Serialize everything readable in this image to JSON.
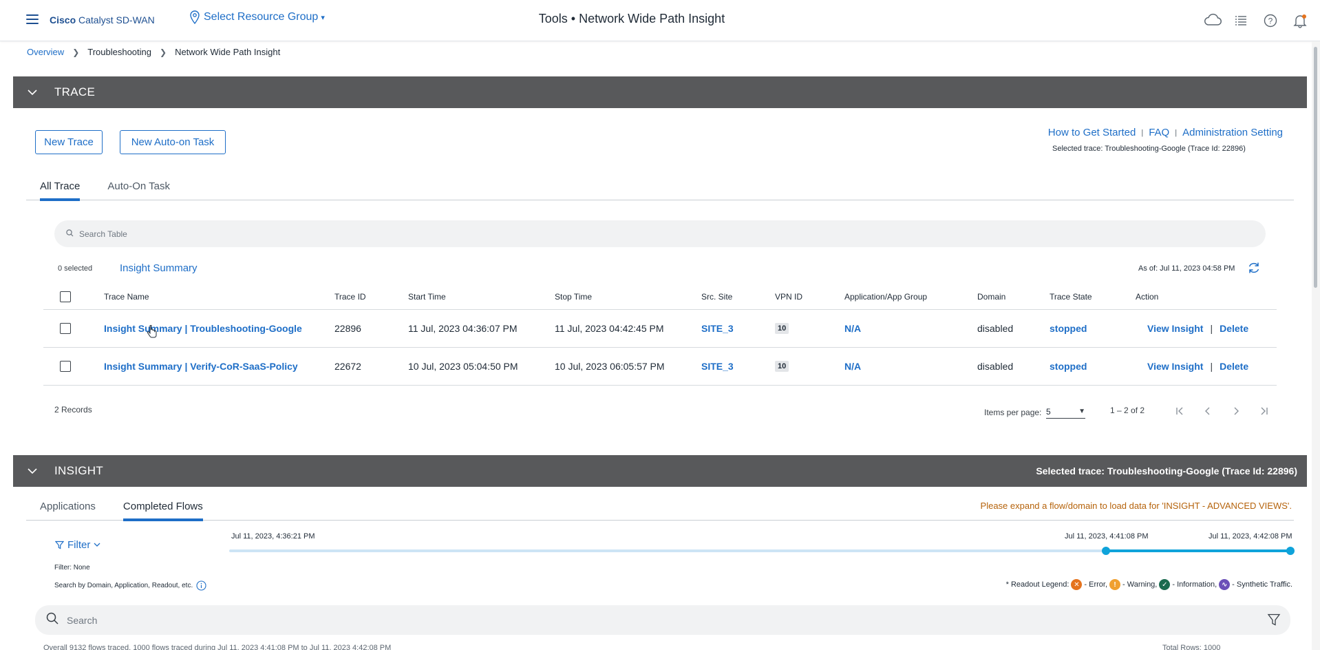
{
  "header": {
    "brand_bold": "Cisco",
    "brand_rest": " Catalyst SD-WAN",
    "resource_group": "Select Resource Group",
    "title_prefix": "Tools • ",
    "title_main": "Network Wide Path Insight"
  },
  "breadcrumb": {
    "items": [
      "Overview",
      "Troubleshooting",
      "Network Wide Path Insight"
    ]
  },
  "trace": {
    "section_title": "TRACE",
    "new_trace_label": "New Trace",
    "new_auto_task_label": "New Auto-on Task",
    "links": [
      "How to Get Started",
      "FAQ",
      "Administration Setting"
    ],
    "selected_trace": "Selected trace: Troubleshooting-Google (Trace Id: 22896)",
    "tabs": [
      "All Trace",
      "Auto-On Task"
    ],
    "search_placeholder": "Search Table",
    "selected_count": "0 selected",
    "insight_summary_label": "Insight Summary",
    "as_of": "As of:  Jul 11, 2023 04:58 PM",
    "columns": [
      "Trace Name",
      "Trace ID",
      "Start Time",
      "Stop Time",
      "Src. Site",
      "VPN ID",
      "Application/App Group",
      "Domain",
      "Trace State",
      "Action"
    ],
    "rows": [
      {
        "name_prefix": "Insight Summary",
        "name_sep": " | ",
        "name": "Troubleshooting-Google",
        "trace_id": "22896",
        "start": "11 Jul, 2023 04:36:07 PM",
        "stop": "11 Jul, 2023 04:42:45 PM",
        "site": "SITE_3",
        "vpn": "10",
        "app": "N/A",
        "domain": "disabled",
        "state": "stopped",
        "view": "View Insight",
        "delete": "Delete"
      },
      {
        "name_prefix": "Insight Summary",
        "name_sep": " | ",
        "name": "Verify-CoR-SaaS-Policy",
        "trace_id": "22672",
        "start": "10 Jul, 2023 05:04:50 PM",
        "stop": "10 Jul, 2023 06:05:57 PM",
        "site": "SITE_3",
        "vpn": "10",
        "app": "N/A",
        "domain": "disabled",
        "state": "stopped",
        "view": "View Insight",
        "delete": "Delete"
      }
    ],
    "records": "2 Records",
    "items_per_page_label": "Items per page:",
    "items_per_page": "5",
    "range": "1 – 2 of 2"
  },
  "insight": {
    "section_title": "INSIGHT",
    "selected_trace": "Selected trace: Troubleshooting-Google (Trace Id: 22896)",
    "tabs": [
      "Applications",
      "Completed Flows"
    ],
    "notice": "Please expand a flow/domain to load data for 'INSIGHT - ADVANCED VIEWS'.",
    "filter_label": "Filter",
    "filter_value": "Filter: None",
    "search_hint": "Search by Domain, Application, Readout, etc.",
    "timeline_labels": [
      "Jul 11, 2023, 4:36:21 PM",
      "Jul 11, 2023, 4:41:08 PM",
      "Jul 11, 2023, 4:42:08 PM"
    ],
    "legend_prefix": "* Readout Legend:",
    "legend_items": [
      "- Error,",
      "- Warning,",
      "- Information,",
      "- Synthetic Traffic."
    ],
    "search_placeholder": "Search",
    "bottom_left": "Overall 9132 flows traced, 1000 flows traced during Jul 11, 2023 4:41:08 PM to Jul 11, 2023 4:42:08 PM",
    "bottom_right": "Total Rows: 1000"
  },
  "colors": {
    "accent": "#1e6ec7",
    "section_bar": "#58595b",
    "timeline": "#0fa3da",
    "error": "#e5731e",
    "warning": "#f0a030",
    "information": "#1b6b4f",
    "synthetic": "#6b4fb8"
  }
}
